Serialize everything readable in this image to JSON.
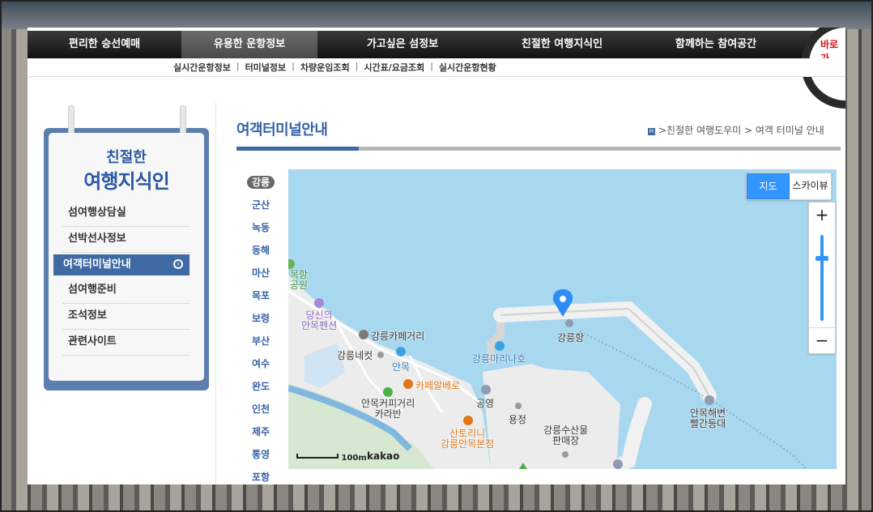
{
  "gnb": {
    "items": [
      "편리한 승선예매",
      "유용한 운항정보",
      "가고싶은 섬정보",
      "친절한 여행지식인",
      "함께하는 참여공간"
    ],
    "active_index": 1,
    "quick_label": "바로가"
  },
  "sub_nav": [
    "실시간운항정보",
    "터미널정보",
    "차량운임조회",
    "시간표/요금조회",
    "실시간운항현황"
  ],
  "sidebar": {
    "title_line1": "친절한",
    "title_line2": "여행지식인",
    "items": [
      "섬여행상담실",
      "선박선사정보",
      "여객터미널안내",
      "섬여행준비",
      "조석정보",
      "관련사이트"
    ],
    "active_index": 2
  },
  "page": {
    "title": "여객터미널안내",
    "breadcrumb_icon": "home-icon",
    "breadcrumb": ">친절한 여행도우미 > 여객 터미널 안내"
  },
  "terminals": {
    "items": [
      "강릉",
      "군산",
      "녹동",
      "동해",
      "마산",
      "목포",
      "보령",
      "부산",
      "여수",
      "완도",
      "인천",
      "제주",
      "통영",
      "포항"
    ],
    "active_index": 0
  },
  "map": {
    "map_type": [
      "지도",
      "스카이뷰"
    ],
    "active_type": 0,
    "zoom_in": "+",
    "zoom_out": "−",
    "scale_label": "100m",
    "brand": "kakao",
    "labels": {
      "park": "목항\n공원",
      "pension": "당신의\n안목펜션",
      "cafe_street": "강릉카페거리",
      "netkut": "강릉네컷",
      "anmok": "안목",
      "cafe_albero": "카페알베로",
      "karaban": "안목커피거리\n카라반",
      "santorini": "산토리니\n강릉안목본점",
      "marina": "강릉마리나호",
      "port": "강릉항",
      "parking": "공영",
      "yongjeong": "용정",
      "seafood": "강릉수산물\n판매장",
      "lighthouse": "안목해변\n빨간등대"
    },
    "colors": {
      "sea": "#a8d8ef",
      "land": "#ececec",
      "accent": "#3396ff"
    }
  }
}
